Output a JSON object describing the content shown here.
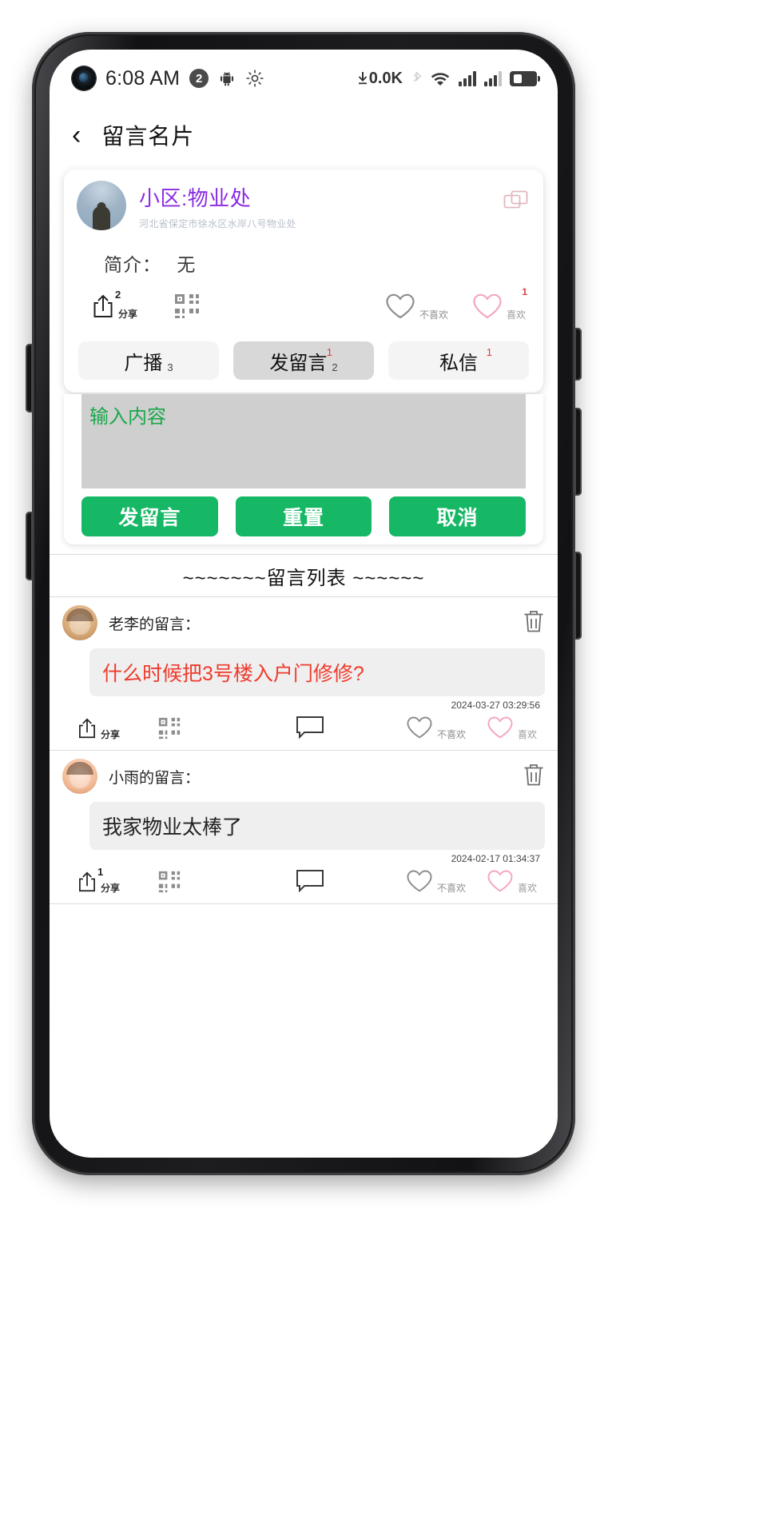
{
  "status_bar": {
    "time": "6:08 AM",
    "notification_count": "2",
    "network_speed": "0.0K",
    "icons": [
      "camera-punch-hole",
      "notification-badge",
      "android-icon",
      "brightness-icon",
      "download-speed-icon",
      "bluetooth-icon",
      "wifi-icon",
      "signal-bars-1",
      "signal-bars-2",
      "battery-icon"
    ]
  },
  "appbar": {
    "back": "‹",
    "title": "留言名片"
  },
  "profile_card": {
    "name": "小区:物业处",
    "address": "河北省保定市徐水区水岸八号物业处",
    "desc_label": "简介：",
    "desc_value": "无",
    "share_label": "分享",
    "share_count": "2",
    "dislike_label": "不喜欢",
    "like_label": "喜欢",
    "like_badge": "1",
    "buttons": [
      {
        "label": "广播",
        "sub": "3",
        "sup": "",
        "active": false
      },
      {
        "label": "发留言",
        "sub": "2",
        "sup": "1",
        "active": true
      },
      {
        "label": "私信",
        "sub": "",
        "sup": "1",
        "active": false
      }
    ]
  },
  "compose": {
    "placeholder": "输入内容",
    "value": "",
    "submit_label": "发留言",
    "reset_label": "重置",
    "cancel_label": "取消"
  },
  "list_divider": "~~~~~~~留言列表 ~~~~~~",
  "messages": [
    {
      "author": "老李的留言：",
      "text": "什么时候把3号楼入户门修修?",
      "time": "2024-03-27 03:29:56",
      "red": true,
      "share_label": "分享",
      "dislike_label": "不喜欢",
      "like_label": "喜欢"
    },
    {
      "author": "小雨的留言：",
      "text": "我家物业太棒了",
      "time": "2024-02-17 01:34:37",
      "red": false,
      "share_label": "分享",
      "dislike_label": "不喜欢",
      "like_label": "喜欢"
    }
  ],
  "colors": {
    "accent_green": "#17b865",
    "name_purple": "#8a2be2",
    "alert_red": "#ef3b2d",
    "placeholder_green": "#1aa84a"
  }
}
